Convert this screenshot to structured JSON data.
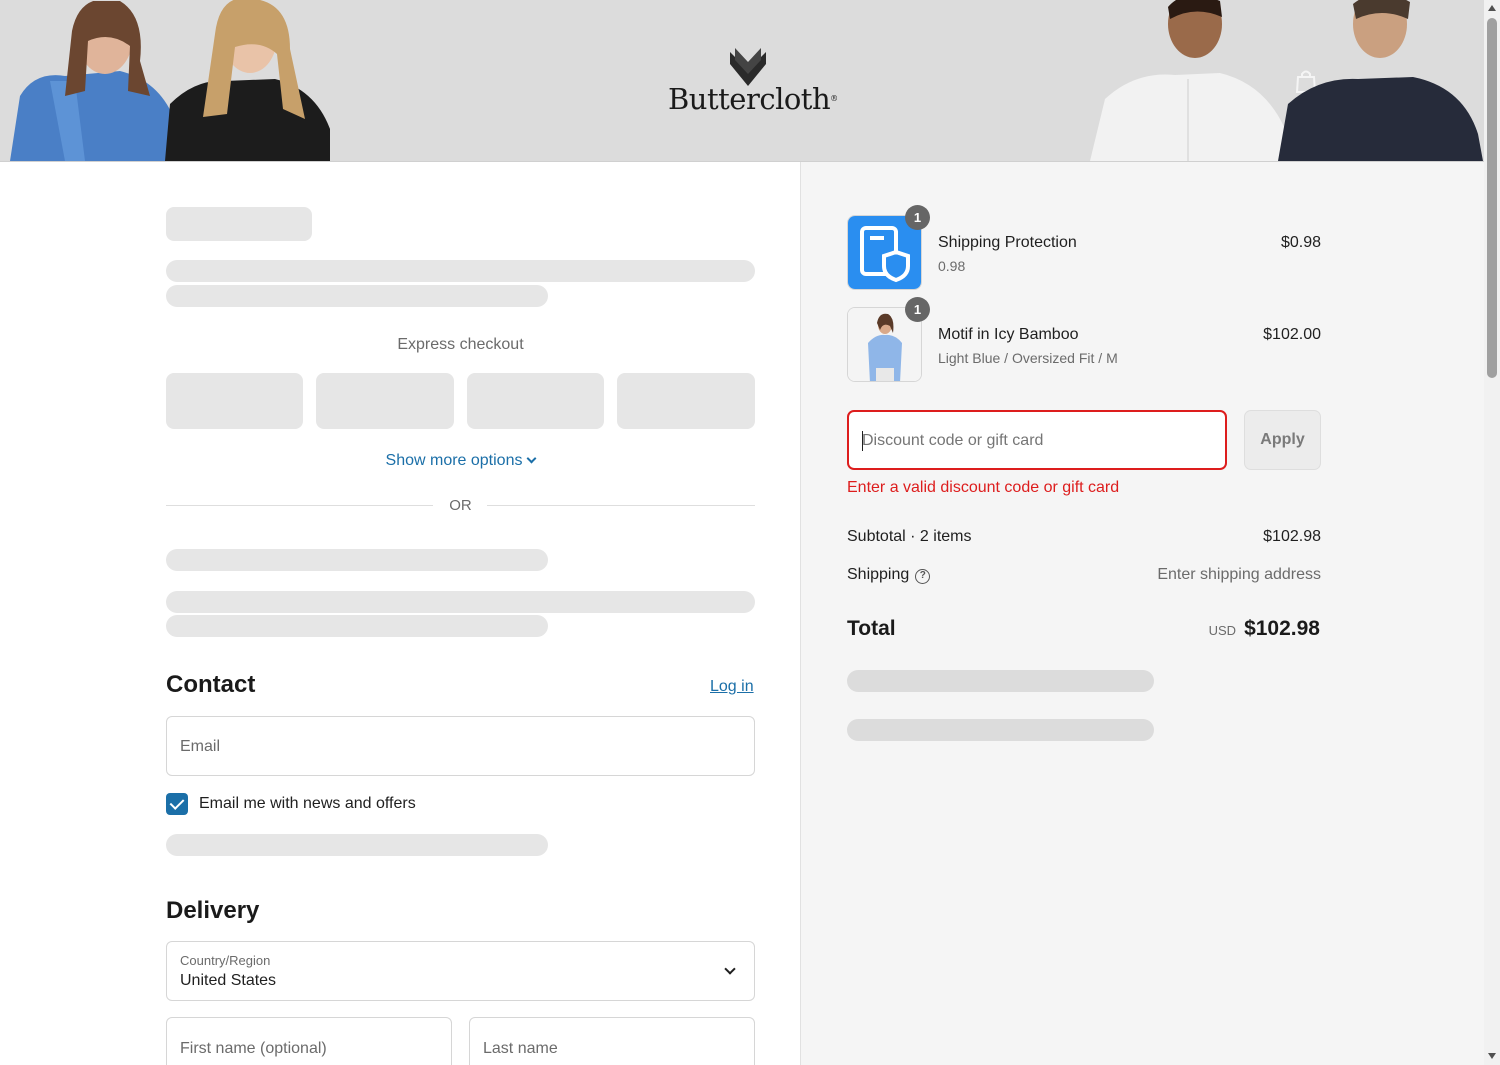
{
  "header": {
    "brand": "Buttercloth",
    "registered": "®"
  },
  "express": {
    "title": "Express checkout",
    "show_more": "Show more options",
    "or_label": "OR"
  },
  "contact": {
    "title": "Contact",
    "login": "Log in",
    "email_placeholder": "Email",
    "newsletter_label": "Email me with news and offers",
    "newsletter_checked": true
  },
  "delivery": {
    "title": "Delivery",
    "country_label": "Country/Region",
    "country_value": "United States",
    "first_name_placeholder": "First name (optional)",
    "last_name_placeholder": "Last name"
  },
  "order": {
    "items": [
      {
        "name": "Shipping Protection",
        "variant": "0.98",
        "price": "$0.98",
        "quantity": "1"
      },
      {
        "name": "Motif in Icy Bamboo",
        "variant": "Light Blue / Oversized Fit / M",
        "price": "$102.00",
        "quantity": "1"
      }
    ],
    "discount_placeholder": "Discount code or gift card",
    "apply_label": "Apply",
    "discount_error": "Enter a valid discount code or gift card",
    "subtotal_label": "Subtotal · 2 items",
    "subtotal_value": "$102.98",
    "shipping_label": "Shipping",
    "shipping_value": "Enter shipping address",
    "total_label": "Total",
    "currency": "USD",
    "total_value": "$102.98"
  },
  "colors": {
    "link": "#1b6fa8",
    "error": "#dd1d1d",
    "skeleton": "#e6e6e6"
  }
}
